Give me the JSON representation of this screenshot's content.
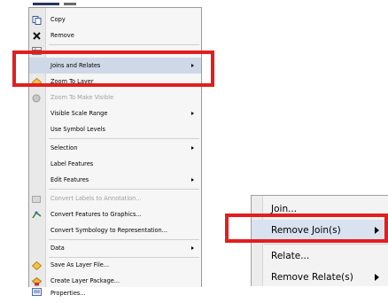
{
  "menu": {
    "items": [
      {
        "label": "Copy",
        "icon": "copy-icon",
        "enabled": true,
        "submenu": false
      },
      {
        "label": "Remove",
        "icon": "close-icon",
        "enabled": true,
        "submenu": false
      },
      {
        "label": "Joins and Relates",
        "icon": "",
        "enabled": true,
        "submenu": true,
        "selected": true
      },
      {
        "label": "Zoom To Layer",
        "icon": "zoom-to-layer-icon",
        "enabled": true,
        "submenu": false
      },
      {
        "label": "Zoom To Make Visible",
        "icon": "zoom-to-make-visible-icon",
        "enabled": false,
        "submenu": false
      },
      {
        "label": "Visible Scale Range",
        "icon": "",
        "enabled": true,
        "submenu": true
      },
      {
        "label": "Use Symbol Levels",
        "icon": "",
        "enabled": true,
        "submenu": false
      },
      {
        "label": "Selection",
        "icon": "",
        "enabled": true,
        "submenu": true
      },
      {
        "label": "Label Features",
        "icon": "",
        "enabled": true,
        "submenu": false
      },
      {
        "label": "Edit Features",
        "icon": "",
        "enabled": true,
        "submenu": true
      },
      {
        "label": "Convert Labels to Annotation...",
        "icon": "convert-labels-icon",
        "enabled": false,
        "submenu": false
      },
      {
        "label": "Convert Features to Graphics...",
        "icon": "convert-features-icon",
        "enabled": true,
        "submenu": false
      },
      {
        "label": "Convert Symbology to Representation...",
        "icon": "",
        "enabled": true,
        "submenu": false
      },
      {
        "label": "Data",
        "icon": "",
        "enabled": true,
        "submenu": true
      },
      {
        "label": "Save As Layer File...",
        "icon": "layer-file-icon",
        "enabled": true,
        "submenu": false
      },
      {
        "label": "Create Layer Package...",
        "icon": "layer-package-icon",
        "enabled": true,
        "submenu": false
      },
      {
        "label": "Properties...",
        "icon": "properties-icon",
        "enabled": true,
        "submenu": false
      }
    ]
  },
  "submenu": {
    "items": [
      {
        "label": "Join...",
        "submenu": false
      },
      {
        "label": "Remove Join(s)",
        "submenu": true,
        "selected": true
      },
      {
        "label": "Relate...",
        "submenu": false
      },
      {
        "label": "Remove Relate(s)",
        "submenu": true
      }
    ]
  },
  "colors": {
    "highlight": "#e21e1e",
    "selection": "#cfd8e6",
    "menu_bg": "#f6f6f6"
  }
}
